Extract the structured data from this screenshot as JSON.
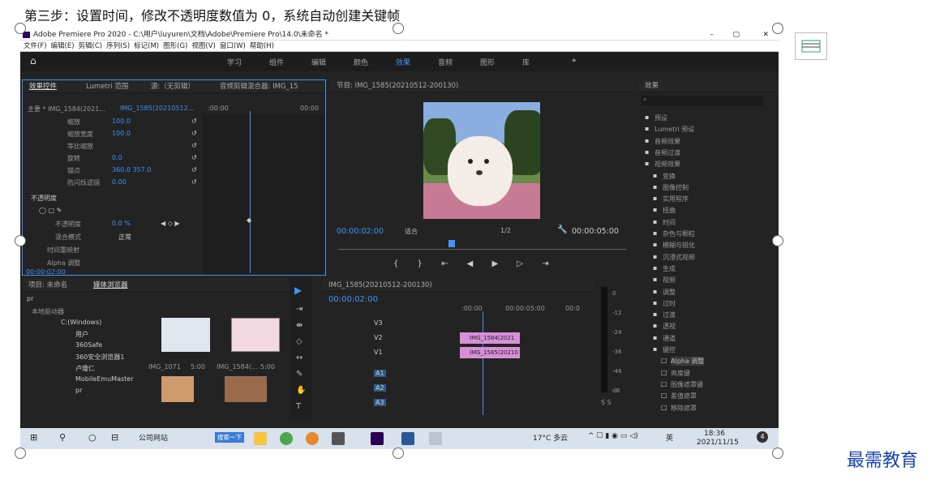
{
  "heading": "第三步：设置时间，修改不透明度数值为 0，系统自动创建关键帧",
  "watermark": "最需教育",
  "window": {
    "title": "Adobe Premiere Pro 2020 - C:\\用户\\luyuren\\文档\\Adobe\\Premiere Pro\\14.0\\未命名 *",
    "min": "–",
    "max": "▢",
    "close": "✕"
  },
  "menu": [
    "文件(F)",
    "编辑(E)",
    "剪辑(C)",
    "序列(S)",
    "标记(M)",
    "图形(G)",
    "视图(V)",
    "窗口(W)",
    "帮助(H)"
  ],
  "workspaces": [
    "学习",
    "组件",
    "编辑",
    "颜色",
    "效果",
    "音频",
    "图形",
    "库"
  ],
  "active_workspace": "效果",
  "effect_controls": {
    "tabs": [
      "效果控件",
      "Lumetri 范围",
      "源:（无剪辑）",
      "音频剪辑混合器: IMG_15"
    ],
    "master": "主要 * IMG_1584(2021...",
    "clip": "IMG_1585(20210512...",
    "t0": ":00:00",
    "t1": "00:00",
    "rows": [
      {
        "name": "缩放",
        "value": "100.0"
      },
      {
        "name": "缩放宽度",
        "value": "100.0"
      },
      {
        "name": "等比缩放",
        "value": ""
      },
      {
        "name": "旋转",
        "value": "0.0"
      },
      {
        "name": "锚点",
        "value": "360.0   357.0"
      },
      {
        "name": "防闪烁滤镜",
        "value": "0.00"
      }
    ],
    "fx_opacity": "不透明度",
    "opacity_label": "不透明度",
    "opacity_value": "0.0 %",
    "blend_label": "混合模式",
    "blend_value": "正常",
    "time_remap": "时间重映射",
    "alpha": "Alpha 调整",
    "timecode": "00:00:02:00"
  },
  "program": {
    "title": "节目: IMG_1585(20210512-200130)",
    "timecode": "00:00:02:00",
    "fit": "适合",
    "quality": "1/2",
    "duration": "00:00:05:00"
  },
  "effects": {
    "title": "效果",
    "items": [
      {
        "label": "预设",
        "level": 0
      },
      {
        "label": "Lumetri 预设",
        "level": 0
      },
      {
        "label": "音频效果",
        "level": 0
      },
      {
        "label": "音频过渡",
        "level": 0
      },
      {
        "label": "视频效果",
        "level": 0
      },
      {
        "label": "变换",
        "level": 1
      },
      {
        "label": "图像控制",
        "level": 1
      },
      {
        "label": "实用程序",
        "level": 1
      },
      {
        "label": "扭曲",
        "level": 1
      },
      {
        "label": "时间",
        "level": 1
      },
      {
        "label": "杂色与颗粒",
        "level": 1
      },
      {
        "label": "模糊与锐化",
        "level": 1
      },
      {
        "label": "沉浸式视频",
        "level": 1
      },
      {
        "label": "生成",
        "level": 1
      },
      {
        "label": "视频",
        "level": 1
      },
      {
        "label": "调整",
        "level": 1
      },
      {
        "label": "过时",
        "level": 1
      },
      {
        "label": "过渡",
        "level": 1
      },
      {
        "label": "透视",
        "level": 1
      },
      {
        "label": "通道",
        "level": 1
      },
      {
        "label": "键控",
        "level": 1
      },
      {
        "label": "Alpha 调整",
        "level": 2
      },
      {
        "label": "亮度键",
        "level": 2
      },
      {
        "label": "图像遮罩键",
        "level": 2
      },
      {
        "label": "差值遮罩",
        "level": 2
      },
      {
        "label": "移除遮罩",
        "level": 2
      }
    ]
  },
  "project": {
    "tabs": [
      "项目: 未命名",
      "媒体浏览器"
    ],
    "path": "pr",
    "local": "本地驱动器",
    "tree": [
      "C:(Windows)",
      "用户",
      "360Safe",
      "360安全浏览器1",
      "卢瓊仁",
      "MobileEmuMaster",
      "pr"
    ],
    "thumbs": [
      {
        "name": "IMG_1071",
        "dur": "5:00"
      },
      {
        "name": "IMG_1584(...",
        "dur": "5:00"
      }
    ]
  },
  "timeline": {
    "title": "IMG_1585(20210512-200130)",
    "timecode": "00:00:02:00",
    "r0": ":00:00",
    "r1": "00:00:05:00",
    "r2": "00:0",
    "video_tracks": [
      "V3",
      "V2",
      "V1"
    ],
    "audio_tracks": [
      "A1",
      "A2",
      "A3"
    ],
    "clips": [
      "IMG_1584(2021",
      "IMG_1585(20210"
    ],
    "meter": [
      "0",
      "-12",
      "-24",
      "-36",
      "-48",
      "dB"
    ],
    "solo": "S S"
  },
  "taskbar": {
    "search_label": "公司网站",
    "search_btn": "搜索一下",
    "weather": "17°C 多云",
    "lang": "英",
    "time": "18:36",
    "date": "2021/11/15",
    "badge": "4"
  },
  "colors": {
    "accent": "#3f94f4",
    "clip": "#d78fd8",
    "ws_active": "#3f94f4"
  }
}
